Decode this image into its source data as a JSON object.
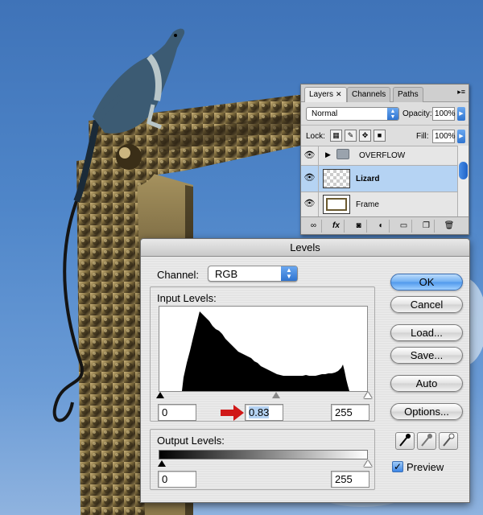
{
  "colors": {
    "sky": "#4f86c9",
    "frame_gold": "#8a7440",
    "accent_blue": "#3d86e6",
    "red_arrow": "#d01818"
  },
  "layers_panel": {
    "tabs": [
      {
        "label": "Layers",
        "close": "✕"
      },
      {
        "label": "Channels"
      },
      {
        "label": "Paths"
      }
    ],
    "menu_icon": "▸≡",
    "blend_mode": "Normal",
    "opacity_label": "Opacity:",
    "opacity_value": "100%",
    "lock_label": "Lock:",
    "fill_label": "Fill:",
    "fill_value": "100%",
    "layers": [
      {
        "name": "OVERFLOW",
        "type": "folder",
        "visible": true,
        "selected": false
      },
      {
        "name": "Lizard",
        "type": "layer",
        "visible": true,
        "selected": true
      },
      {
        "name": "Frame",
        "type": "layer",
        "visible": true,
        "selected": false
      }
    ],
    "bottom_icons": [
      "link-icon",
      "fx-icon",
      "mask-icon",
      "adjustment-icon",
      "group-icon",
      "new-layer-icon",
      "trash-icon"
    ],
    "fx_label": "fx"
  },
  "levels": {
    "title": "Levels",
    "channel_label": "Channel:",
    "channel_value": "RGB",
    "input_levels_label": "Input Levels:",
    "input_black": "0",
    "input_gamma": "0.83",
    "input_white": "255",
    "output_levels_label": "Output Levels:",
    "output_black": "0",
    "output_white": "255",
    "buttons": {
      "ok": "OK",
      "cancel": "Cancel",
      "load": "Load...",
      "save": "Save...",
      "auto": "Auto",
      "options": "Options..."
    },
    "preview_label": "Preview",
    "preview_checked": true
  }
}
